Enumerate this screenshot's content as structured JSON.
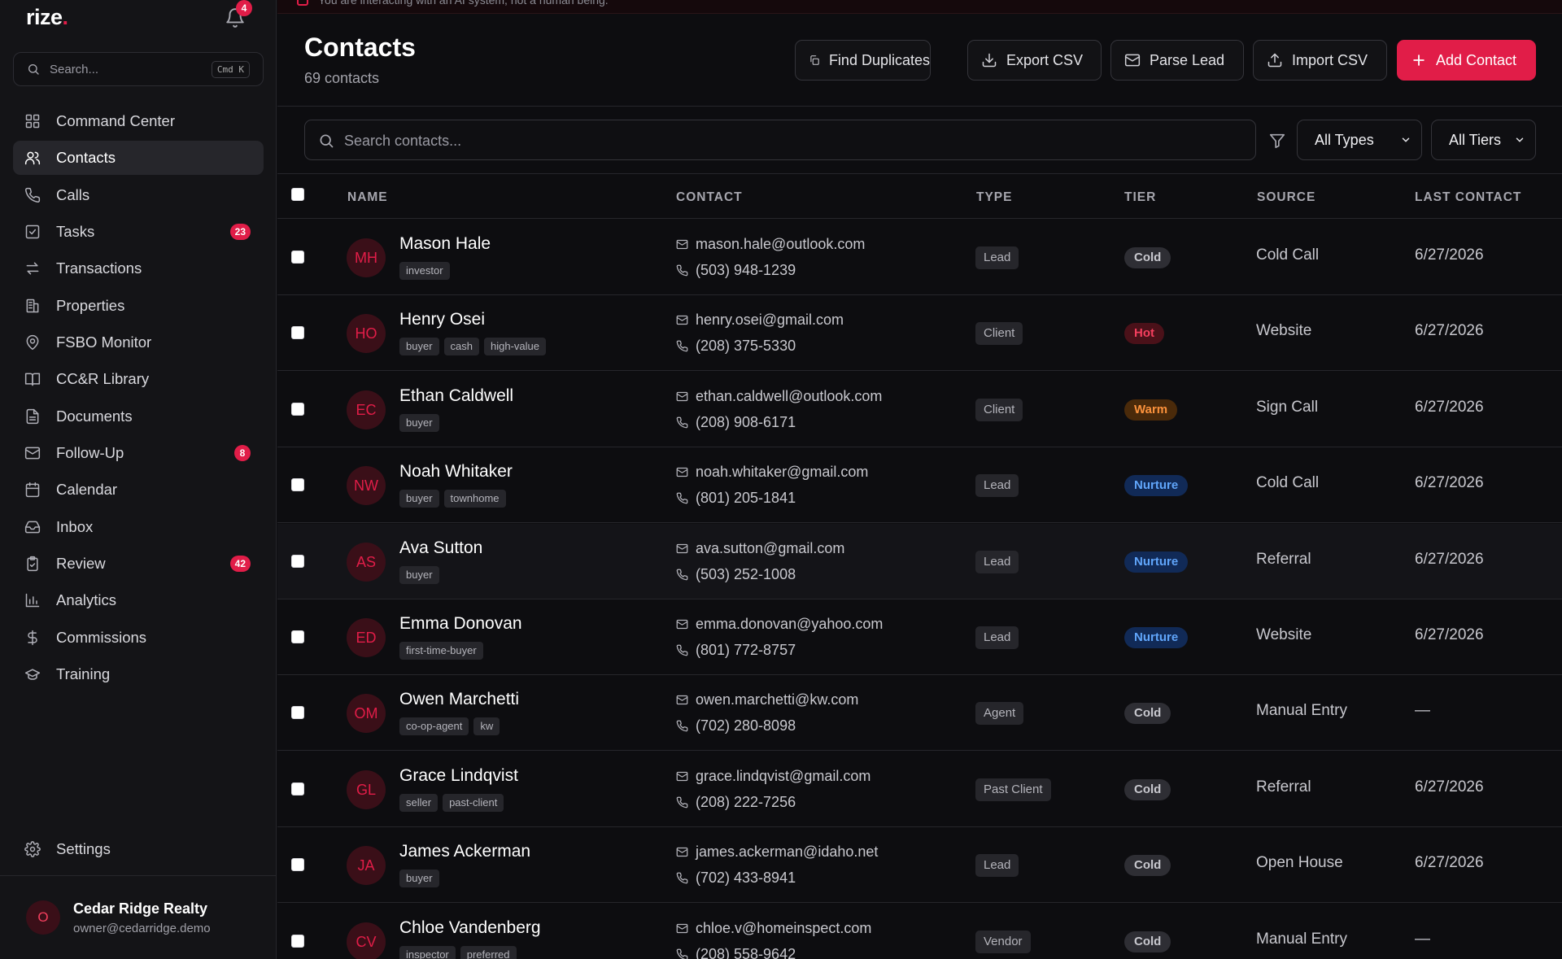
{
  "app": {
    "logo": "rize",
    "logo_dot": ".",
    "notification_count": "4",
    "search_placeholder": "Search...",
    "search_shortcut": "Cmd K"
  },
  "sidebar": {
    "items": [
      {
        "label": "Command Center",
        "icon": "grid-icon",
        "badge": ""
      },
      {
        "label": "Contacts",
        "icon": "users-icon",
        "badge": "",
        "active": true
      },
      {
        "label": "Calls",
        "icon": "phone-icon",
        "badge": ""
      },
      {
        "label": "Tasks",
        "icon": "check-square-icon",
        "badge": "23"
      },
      {
        "label": "Transactions",
        "icon": "arrows-icon",
        "badge": ""
      },
      {
        "label": "Properties",
        "icon": "building-icon",
        "badge": ""
      },
      {
        "label": "FSBO Monitor",
        "icon": "map-pin-icon",
        "badge": ""
      },
      {
        "label": "CC&R Library",
        "icon": "book-icon",
        "badge": ""
      },
      {
        "label": "Documents",
        "icon": "file-icon",
        "badge": ""
      },
      {
        "label": "Follow-Up",
        "icon": "mail-icon",
        "badge": "8"
      },
      {
        "label": "Calendar",
        "icon": "calendar-icon",
        "badge": ""
      },
      {
        "label": "Inbox",
        "icon": "inbox-icon",
        "badge": ""
      },
      {
        "label": "Review",
        "icon": "clipboard-icon",
        "badge": "42"
      },
      {
        "label": "Analytics",
        "icon": "bar-chart-icon",
        "badge": ""
      },
      {
        "label": "Commissions",
        "icon": "dollar-icon",
        "badge": ""
      },
      {
        "label": "Training",
        "icon": "graduation-cap-icon",
        "badge": ""
      }
    ],
    "settings_label": "Settings",
    "org": {
      "initial": "O",
      "name": "Cedar Ridge Realty",
      "email": "owner@cedarridge.demo"
    }
  },
  "banner": {
    "text": "You are interacting with an AI system, not a human being."
  },
  "header": {
    "title": "Contacts",
    "subtitle": "69 contacts",
    "buttons": {
      "find_duplicates": "Find Duplicates",
      "export_csv": "Export CSV",
      "parse_lead": "Parse Lead",
      "import_csv": "Import CSV",
      "add_contact": "Add Contact"
    }
  },
  "filters": {
    "search_placeholder": "Search contacts...",
    "type_selected": "All Types",
    "tier_selected": "All Tiers"
  },
  "table": {
    "columns": {
      "name": "NAME",
      "contact": "CONTACT",
      "type": "TYPE",
      "tier": "TIER",
      "source": "SOURCE",
      "last_contact": "LAST CONTACT"
    },
    "rows": [
      {
        "initials": "MH",
        "name": "Mason Hale",
        "tags": [
          "investor"
        ],
        "email": "mason.hale@outlook.com",
        "phone": "(503) 948-1239",
        "type": "Lead",
        "tier": "Cold",
        "source": "Cold Call",
        "last": "6/27/2026"
      },
      {
        "initials": "HO",
        "name": "Henry Osei",
        "tags": [
          "buyer",
          "cash",
          "high-value"
        ],
        "email": "henry.osei@gmail.com",
        "phone": "(208) 375-5330",
        "type": "Client",
        "tier": "Hot",
        "source": "Website",
        "last": "6/27/2026"
      },
      {
        "initials": "EC",
        "name": "Ethan Caldwell",
        "tags": [
          "buyer"
        ],
        "email": "ethan.caldwell@outlook.com",
        "phone": "(208) 908-6171",
        "type": "Client",
        "tier": "Warm",
        "source": "Sign Call",
        "last": "6/27/2026"
      },
      {
        "initials": "NW",
        "name": "Noah Whitaker",
        "tags": [
          "buyer",
          "townhome"
        ],
        "email": "noah.whitaker@gmail.com",
        "phone": "(801) 205-1841",
        "type": "Lead",
        "tier": "Nurture",
        "source": "Cold Call",
        "last": "6/27/2026"
      },
      {
        "initials": "AS",
        "name": "Ava Sutton",
        "tags": [
          "buyer"
        ],
        "email": "ava.sutton@gmail.com",
        "phone": "(503) 252-1008",
        "type": "Lead",
        "tier": "Nurture",
        "source": "Referral",
        "last": "6/27/2026",
        "highlight": true
      },
      {
        "initials": "ED",
        "name": "Emma Donovan",
        "tags": [
          "first-time-buyer"
        ],
        "email": "emma.donovan@yahoo.com",
        "phone": "(801) 772-8757",
        "type": "Lead",
        "tier": "Nurture",
        "source": "Website",
        "last": "6/27/2026"
      },
      {
        "initials": "OM",
        "name": "Owen Marchetti",
        "tags": [
          "co-op-agent",
          "kw"
        ],
        "email": "owen.marchetti@kw.com",
        "phone": "(702) 280-8098",
        "type": "Agent",
        "tier": "Cold",
        "source": "Manual Entry",
        "last": "—"
      },
      {
        "initials": "GL",
        "name": "Grace Lindqvist",
        "tags": [
          "seller",
          "past-client"
        ],
        "email": "grace.lindqvist@gmail.com",
        "phone": "(208) 222-7256",
        "type": "Past Client",
        "tier": "Cold",
        "source": "Referral",
        "last": "6/27/2026"
      },
      {
        "initials": "JA",
        "name": "James Ackerman",
        "tags": [
          "buyer"
        ],
        "email": "james.ackerman@idaho.net",
        "phone": "(702) 433-8941",
        "type": "Lead",
        "tier": "Cold",
        "source": "Open House",
        "last": "6/27/2026"
      },
      {
        "initials": "CV",
        "name": "Chloe Vandenberg",
        "tags": [
          "inspector",
          "preferred"
        ],
        "email": "chloe.v@homeinspect.com",
        "phone": "(208) 558-9642",
        "type": "Vendor",
        "tier": "Cold",
        "source": "Manual Entry",
        "last": "—"
      }
    ]
  },
  "colors": {
    "accent": "#e11d48",
    "background": "#0d0d10",
    "sidebar": "#141417",
    "tier_hot": "#f43f5e",
    "tier_warm": "#fb923c",
    "tier_nurture": "#60a5fa"
  }
}
